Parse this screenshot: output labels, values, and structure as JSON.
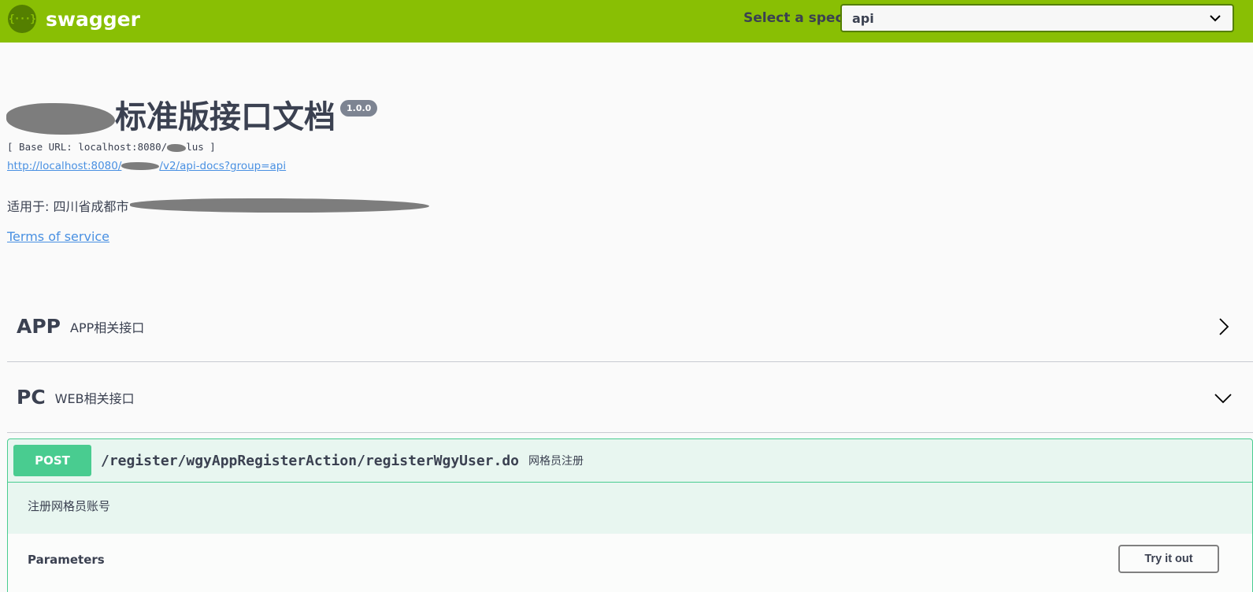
{
  "topbar": {
    "logo_glyph": "{···}",
    "logo_text": "swagger",
    "spec_label": "Select a spec",
    "spec_selected": "api",
    "accent_color": "#89bf04"
  },
  "info": {
    "title": "标准版接口文档",
    "version": "1.0.0",
    "base_url_prefix": "[ Base URL: localhost:8080/",
    "base_url_suffix": "lus ]",
    "docs_link_prefix": "http://localhost:8080/",
    "docs_link_suffix": "/v2/api-docs?group=api",
    "applies_to": "适用于: 四川省成都市",
    "terms_of_service": "Terms of service"
  },
  "tags": [
    {
      "name": "APP",
      "description": "APP相关接口",
      "expanded": false
    },
    {
      "name": "PC",
      "description": "WEB相关接口",
      "expanded": true
    }
  ],
  "operation": {
    "method": "POST",
    "path": "/register/wgyAppRegisterAction/registerWgyUser.do",
    "summary": "网格员注册",
    "description": "注册网格员账号",
    "parameters_title": "Parameters",
    "try_button": "Try it out",
    "method_color": "#49cc90"
  }
}
